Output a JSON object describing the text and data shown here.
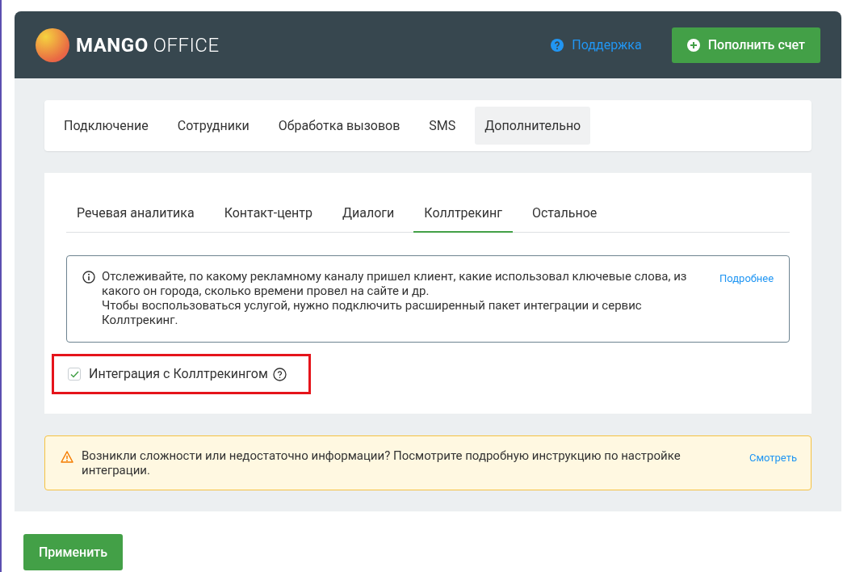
{
  "header": {
    "logo": {
      "brand": "MANGO",
      "suffix": "OFFICE"
    },
    "support_link": "Поддержка",
    "topup_button": "Пополнить счет"
  },
  "main_tabs": [
    {
      "label": "Подключение",
      "selected": false
    },
    {
      "label": "Сотрудники",
      "selected": false
    },
    {
      "label": "Обработка вызовов",
      "selected": false
    },
    {
      "label": "SMS",
      "selected": false
    },
    {
      "label": "Дополнительно",
      "selected": true
    }
  ],
  "sub_tabs": [
    {
      "label": "Речевая аналитика",
      "selected": false
    },
    {
      "label": "Контакт-центр",
      "selected": false
    },
    {
      "label": "Диалоги",
      "selected": false
    },
    {
      "label": "Коллтрекинг",
      "selected": true
    },
    {
      "label": "Остальное",
      "selected": false
    }
  ],
  "info_box": {
    "paragraphs": [
      "Отслеживайте, по какому рекламному каналу пришел клиент, какие использовал ключевые слова, из какого он города, сколько времени провел на сайте и др.",
      "Чтобы воспользоваться услугой, нужно подключить расширенный пакет интеграции и сервис Коллтрекинг."
    ],
    "link": "Подробнее"
  },
  "integration_checkbox": {
    "label": "Интеграция с Коллтрекингом",
    "checked": true,
    "highlighted": true
  },
  "warning_box": {
    "text": "Возникли сложности или недостаточно информации? Посмотрите подробную инструкцию по настройке интеграции.",
    "link": "Смотреть"
  },
  "apply_button": "Применить"
}
